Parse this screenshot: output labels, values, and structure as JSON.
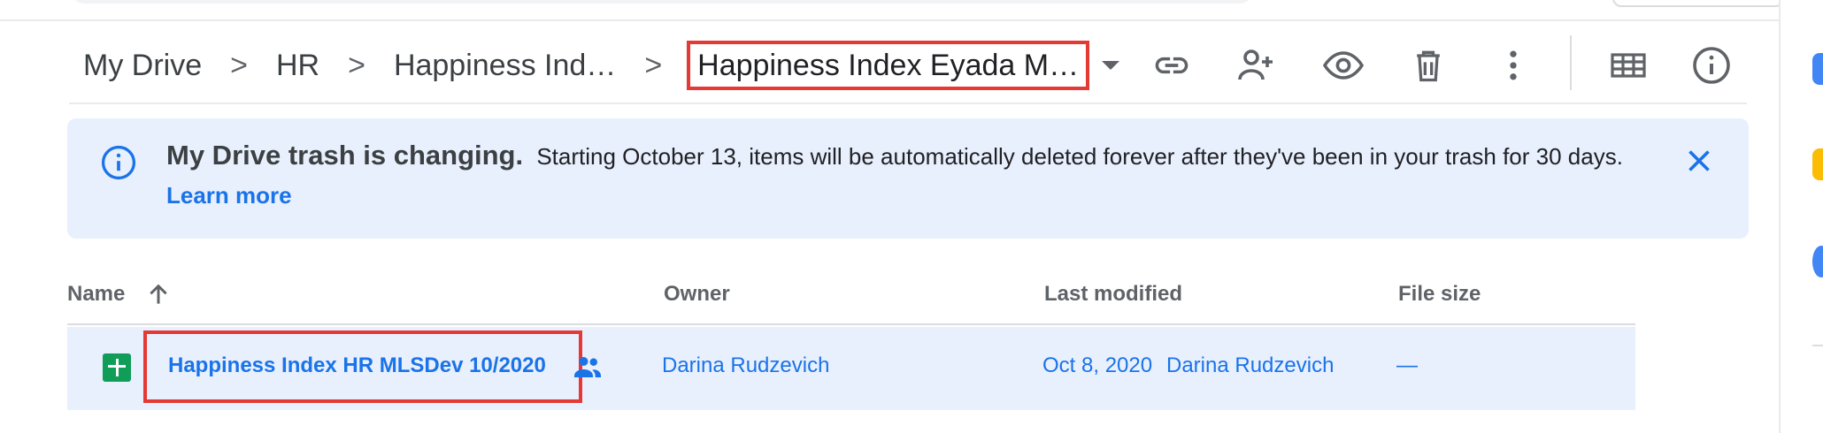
{
  "breadcrumb": {
    "items": [
      "My Drive",
      "HR",
      "Happiness Ind…"
    ],
    "current": "Happiness Index Eyada M…",
    "separator": ">"
  },
  "toolbar": {
    "icons": [
      "link-icon",
      "add-person-icon",
      "eye-icon",
      "trash-icon",
      "more-vert-icon",
      "grid-view-icon",
      "info-icon"
    ]
  },
  "banner": {
    "headline": "My Drive trash is changing.",
    "body": "Starting October 13, items will be automatically deleted forever after they've been in your trash for 30 days.",
    "link": "Learn more"
  },
  "table": {
    "headers": {
      "name": "Name",
      "owner": "Owner",
      "last_modified": "Last modified",
      "file_size": "File size"
    },
    "rows": [
      {
        "name": "Happiness Index HR MLSDev 10/2020",
        "owner": "Darina Rudzevich",
        "modified_date": "Oct 8, 2020",
        "modified_by": "Darina Rudzevich",
        "size": "—"
      }
    ]
  },
  "colors": {
    "accent": "#1a73e8",
    "highlight_box": "#e53935",
    "banner_bg": "#e8f0fe",
    "sheets_green": "#0f9d58"
  }
}
